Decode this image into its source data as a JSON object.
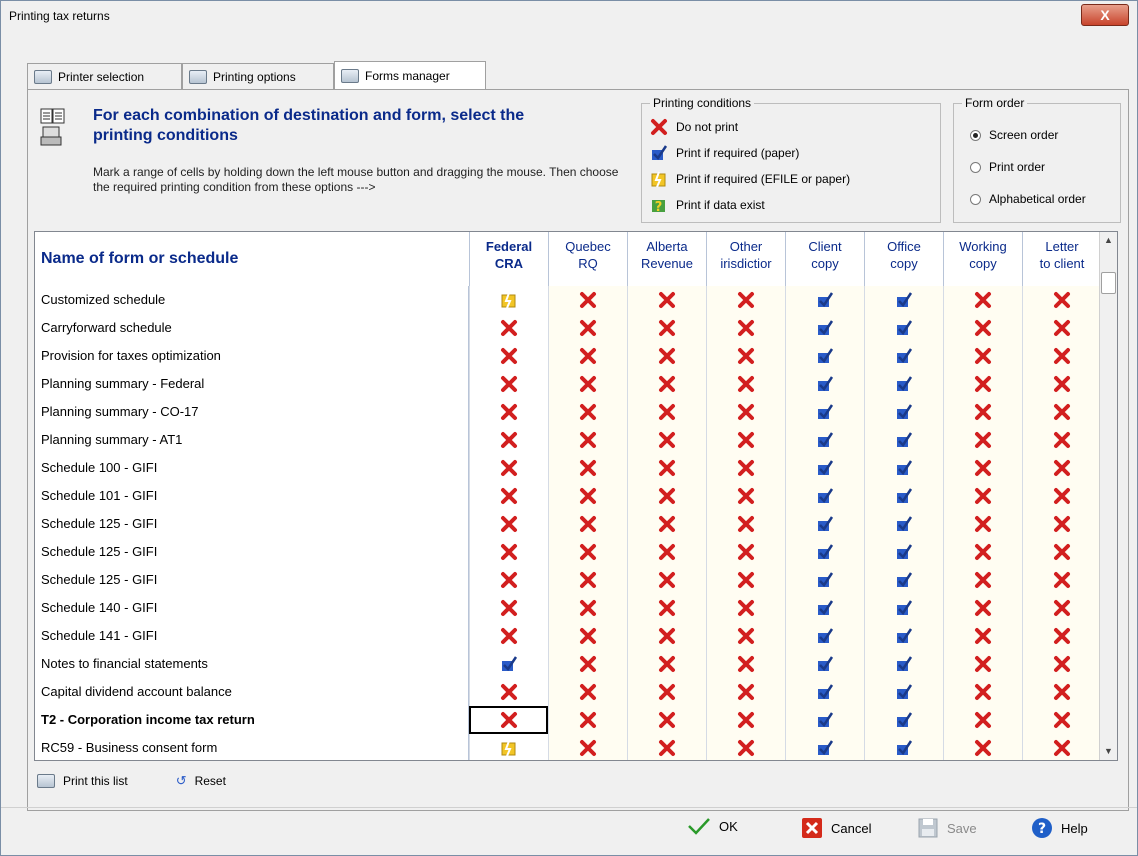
{
  "window": {
    "title": "Printing tax returns",
    "close_label": "X"
  },
  "tabs": [
    {
      "label": "Printer selection",
      "icon": "printer-icon",
      "active": false
    },
    {
      "label": "Printing options",
      "icon": "printer-options-icon",
      "active": false
    },
    {
      "label": "Forms manager",
      "icon": "forms-manager-icon",
      "active": true
    }
  ],
  "header": {
    "title": "For each combination of destination and form, select the printing conditions",
    "description": "Mark a range of cells by holding down the left mouse button and dragging the mouse. Then choose the required printing condition from these options --->"
  },
  "printing_conditions": {
    "title": "Printing conditions",
    "items": [
      {
        "label": "Do not print",
        "icon": "x"
      },
      {
        "label": "Print if required (paper)",
        "icon": "check"
      },
      {
        "label": "Print if required (EFILE or paper)",
        "icon": "efile"
      },
      {
        "label": "Print if data exist",
        "icon": "data"
      }
    ]
  },
  "form_order": {
    "title": "Form order",
    "options": [
      {
        "label": "Screen order",
        "selected": true
      },
      {
        "label": "Print order",
        "selected": false
      },
      {
        "label": "Alphabetical order",
        "selected": false
      }
    ]
  },
  "grid": {
    "name_header": "Name of form or schedule",
    "columns": [
      {
        "line1": "Federal",
        "line2": "CRA"
      },
      {
        "line1": "Quebec",
        "line2": "RQ"
      },
      {
        "line1": "Alberta",
        "line2": "Revenue"
      },
      {
        "line1": "Other",
        "line2": "irisdictior"
      },
      {
        "line1": "Client",
        "line2": "copy"
      },
      {
        "line1": "Office",
        "line2": "copy"
      },
      {
        "line1": "Working",
        "line2": "copy"
      },
      {
        "line1": "Letter",
        "line2": "to client"
      }
    ],
    "rows": [
      {
        "name": "Customized schedule",
        "bold": false,
        "cells": [
          "efile",
          "x",
          "x",
          "x",
          "check",
          "check",
          "x",
          "x"
        ]
      },
      {
        "name": "Carryforward schedule",
        "bold": false,
        "cells": [
          "x",
          "x",
          "x",
          "x",
          "check",
          "check",
          "x",
          "x"
        ]
      },
      {
        "name": "Provision for taxes optimization",
        "bold": false,
        "cells": [
          "x",
          "x",
          "x",
          "x",
          "check",
          "check",
          "x",
          "x"
        ]
      },
      {
        "name": "Planning summary - Federal",
        "bold": false,
        "cells": [
          "x",
          "x",
          "x",
          "x",
          "check",
          "check",
          "x",
          "x"
        ]
      },
      {
        "name": "Planning summary - CO-17",
        "bold": false,
        "cells": [
          "x",
          "x",
          "x",
          "x",
          "check",
          "check",
          "x",
          "x"
        ]
      },
      {
        "name": "Planning summary - AT1",
        "bold": false,
        "cells": [
          "x",
          "x",
          "x",
          "x",
          "check",
          "check",
          "x",
          "x"
        ]
      },
      {
        "name": "Schedule 100 - GIFI",
        "bold": false,
        "cells": [
          "x",
          "x",
          "x",
          "x",
          "check",
          "check",
          "x",
          "x"
        ]
      },
      {
        "name": "Schedule 101 - GIFI",
        "bold": false,
        "cells": [
          "x",
          "x",
          "x",
          "x",
          "check",
          "check",
          "x",
          "x"
        ]
      },
      {
        "name": "Schedule 125 - GIFI",
        "bold": false,
        "cells": [
          "x",
          "x",
          "x",
          "x",
          "check",
          "check",
          "x",
          "x"
        ]
      },
      {
        "name": "Schedule 125 - GIFI",
        "bold": false,
        "cells": [
          "x",
          "x",
          "x",
          "x",
          "check",
          "check",
          "x",
          "x"
        ]
      },
      {
        "name": "Schedule 125 - GIFI",
        "bold": false,
        "cells": [
          "x",
          "x",
          "x",
          "x",
          "check",
          "check",
          "x",
          "x"
        ]
      },
      {
        "name": "Schedule 140 - GIFI",
        "bold": false,
        "cells": [
          "x",
          "x",
          "x",
          "x",
          "check",
          "check",
          "x",
          "x"
        ]
      },
      {
        "name": "Schedule 141 - GIFI",
        "bold": false,
        "cells": [
          "x",
          "x",
          "x",
          "x",
          "check",
          "check",
          "x",
          "x"
        ]
      },
      {
        "name": "Notes to financial statements",
        "bold": false,
        "cells": [
          "check",
          "x",
          "x",
          "x",
          "check",
          "check",
          "x",
          "x"
        ]
      },
      {
        "name": "Capital dividend account balance",
        "bold": false,
        "cells": [
          "x",
          "x",
          "x",
          "x",
          "check",
          "check",
          "x",
          "x"
        ]
      },
      {
        "name": "T2 - Corporation income tax return",
        "bold": true,
        "cells": [
          "x",
          "x",
          "x",
          "x",
          "check",
          "check",
          "x",
          "x"
        ]
      },
      {
        "name": "RC59 - Business consent form",
        "bold": false,
        "cells": [
          "efile",
          "x",
          "x",
          "x",
          "check",
          "check",
          "x",
          "x"
        ]
      }
    ]
  },
  "bottom_links": {
    "print_list": "Print this list",
    "reset": "Reset"
  },
  "footer": {
    "ok": "OK",
    "cancel": "Cancel",
    "save": "Save",
    "help": "Help"
  },
  "colors": {
    "accent_text": "#0a2a8a",
    "x_red": "#d21f1f",
    "check_blue": "#2a5bc8",
    "efile_yellow": "#f2c526"
  }
}
